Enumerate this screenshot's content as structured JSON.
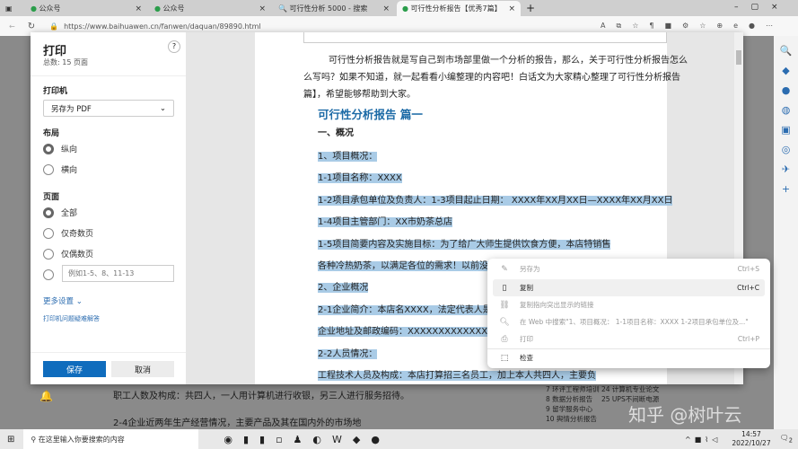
{
  "browser": {
    "tabs": [
      {
        "label": "公众号"
      },
      {
        "label": "公众号"
      },
      {
        "label": "可行性分析 5000 - 搜索"
      },
      {
        "label": "可行性分析报告【优秀7篇】"
      }
    ],
    "url": "https://www.baihuawen.cn/fanwen/daquan/89890.html"
  },
  "print": {
    "title": "打印",
    "total": "总数: 15 页面",
    "help": "?",
    "printer_label": "打印机",
    "printer_value": "另存为 PDF",
    "layout_label": "布局",
    "layout_options": [
      "纵向",
      "横向"
    ],
    "layout_selected": "纵向",
    "pages_label": "页面",
    "pages_options": [
      "全部",
      "仅奇数页",
      "仅偶数页"
    ],
    "pages_selected": "全部",
    "custom_placeholder": "例如1-5、8、11-13",
    "more_settings": "更多设置",
    "troubleshoot": "打印机问题疑难解答",
    "save": "保存",
    "cancel": "取消"
  },
  "preview": {
    "intro": [
      "可行性分析报告就是写自己到市场部里做一个分析的报告，那么，关于可行性分析报告怎么",
      "么写吗？如果不知道，就一起看看小编整理的内容吧！白话文为大家精心整理了可行性分析报告",
      "篇】，希望能够帮助到大家。"
    ],
    "heading": "可行性分析报告 篇一",
    "sub": "一、概况",
    "lines": [
      "1、项目概况：",
      "1-1项目名称：XXXX",
      "1-2项目承包单位及负责人：1-3项目起止日期： XXXX年XX月XX日—XXXX年XX月XX日",
      "1-4项目主管部门：XX市奶茶总店",
      "1-5项目简要内容及实施目标：为了给广大师生提供饮食方便，本店特销售",
      "各种冷热奶茶，以满足各位的需求！以前没有中",
      "2、企业概况",
      "2-1企业简介：本店名XXXX，法定代表人是XX",
      "企业地址及邮政编码：XXXXXXXXXXXXXXXX",
      "2-2人员情况：",
      "工程技术人员及构成：本店打算招三名员工，加上本人共四人，主要负"
    ]
  },
  "context_menu": [
    {
      "label": "另存为",
      "shortcut": "Ctrl+S",
      "icon": "save-icon",
      "enabled": false
    },
    {
      "label": "复制",
      "shortcut": "Ctrl+C",
      "icon": "copy-icon",
      "enabled": true
    },
    {
      "label": "复制指向突出显示的链接",
      "shortcut": "",
      "icon": "link-icon",
      "enabled": false
    },
    {
      "label": "在 Web 中搜索\"1、项目概况： 1-1项目名称：XXXX 1-2项目承包单位及...\"",
      "shortcut": "",
      "icon": "search-icon",
      "enabled": false
    },
    {
      "label": "打印",
      "shortcut": "Ctrl+P",
      "icon": "print-icon",
      "enabled": false
    },
    {
      "label": "检查",
      "shortcut": "",
      "icon": "inspect-icon",
      "enabled": true
    }
  ],
  "background": {
    "lines": [
      "职工人数及构成：共四人，一人用计算机进行收银，另三人进行服务招待。",
      "2-4企业近两年生产经营情况，主要产品及其在国内外的市场地"
    ],
    "list": [
      [
        "7 环评工程师培训",
        "24 计算机专业论文"
      ],
      [
        "8 数据分析报告",
        "25 UPS不间断电源"
      ],
      [
        "9 留学服务中心",
        ""
      ],
      [
        "10 舆情分析报告",
        ""
      ]
    ]
  },
  "taskbar": {
    "search_placeholder": "在这里输入你要搜索的内容",
    "time": "14:57",
    "date": "2022/10/27",
    "notifications": "2"
  },
  "watermark": "知乎 @树叶云"
}
